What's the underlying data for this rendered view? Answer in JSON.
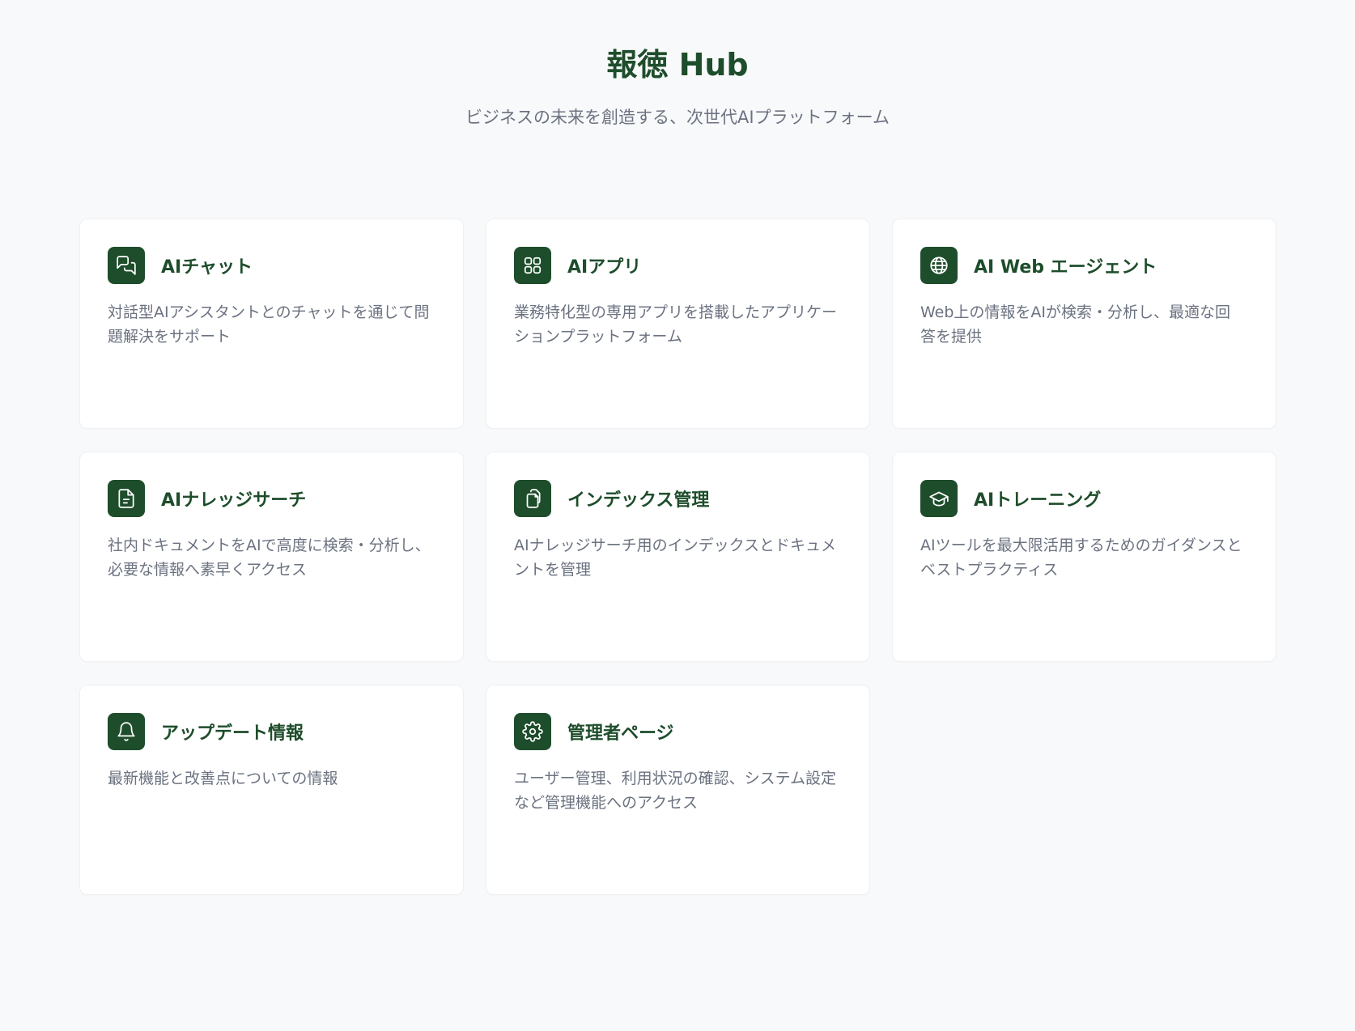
{
  "header": {
    "title": "報徳 Hub",
    "subtitle": "ビジネスの未来を創造する、次世代AIプラットフォーム"
  },
  "colors": {
    "accent": "#1e4d2b",
    "background": "#f8f9fb",
    "card": "#ffffff",
    "description_text": "#6b7280"
  },
  "cards": [
    {
      "title": "AIチャット",
      "description": "対話型AIアシスタントとのチャットを通じて問題解決をサポート",
      "icon": "chat-bubbles-icon"
    },
    {
      "title": "AIアプリ",
      "description": "業務特化型の専用アプリを搭載したアプリケーションプラットフォーム",
      "icon": "grid-apps-icon"
    },
    {
      "title": "AI Web エージェント",
      "description": "Web上の情報をAIが検索・分析し、最適な回答を提供",
      "icon": "globe-icon"
    },
    {
      "title": "AIナレッジサーチ",
      "description": "社内ドキュメントをAIで高度に検索・分析し、必要な情報へ素早くアクセス",
      "icon": "document-icon"
    },
    {
      "title": "インデックス管理",
      "description": "AIナレッジサーチ用のインデックスとドキュメントを管理",
      "icon": "copy-documents-icon"
    },
    {
      "title": "AIトレーニング",
      "description": "AIツールを最大限活用するためのガイダンスとベストプラクティス",
      "icon": "graduation-cap-icon"
    },
    {
      "title": "アップデート情報",
      "description": "最新機能と改善点についての情報",
      "icon": "bell-icon"
    },
    {
      "title": "管理者ページ",
      "description": "ユーザー管理、利用状況の確認、システム設定など管理機能へのアクセス",
      "icon": "gear-icon"
    }
  ]
}
